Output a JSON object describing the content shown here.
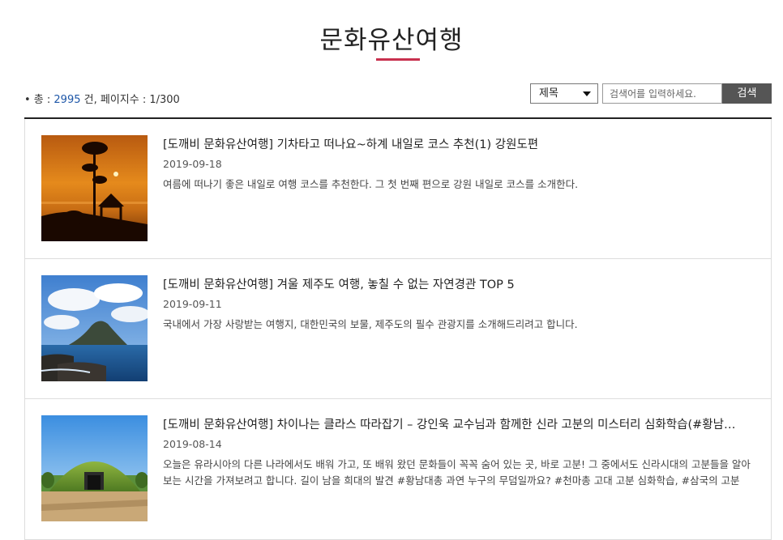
{
  "page": {
    "title": "문화유산여행"
  },
  "summary": {
    "prefix": "• 총 : ",
    "total": "2995",
    "middle": " 건, 페이지수 : ",
    "pages": "1/300"
  },
  "search": {
    "select_value": "제목",
    "placeholder": "검색어를 입력하세요.",
    "button_label": "검색"
  },
  "items": [
    {
      "title": "[도깨비 문화유산여행] 기차타고 떠나요~하계 내일로 코스 추천(1) 강원도편",
      "date": "2019-09-18",
      "desc": "여름에 떠나기 좋은 내일로 여행 코스를 추천한다. 그 첫 번째 편으로 강원 내일로 코스를 소개한다.",
      "image": "sunset-pavilion-photo"
    },
    {
      "title": "[도깨비 문화유산여행] 겨울 제주도 여행, 놓칠 수 없는 자연경관 TOP 5",
      "date": "2019-09-11",
      "desc": "국내에서 가장 사랑받는 여행지, 대한민국의 보물, 제주도의 필수 관광지를 소개해드리려고 합니다.",
      "image": "jeju-coast-photo"
    },
    {
      "title": "[도깨비 문화유산여행] 차이나는 클라스 따라잡기 – 강인욱 교수님과 함께한 신라 고분의 미스터리 심화학습(#황남…",
      "date": "2019-08-14",
      "desc": "오늘은 유라시아의 다른 나라에서도 배워 가고, 또 배워 왔던 문화들이 꼭꼭 숨어 있는 곳, 바로 고분! 그 중에서도 신라시대의 고분들을 알아보는 시간을 가져보려고 합니다. 길이 남을 희대의 발견 #황남대총 과연 누구의 무덤일까요? #천마총 고대 고분 심화학습, #삼국의 고분",
      "image": "silla-tomb-photo"
    }
  ]
}
